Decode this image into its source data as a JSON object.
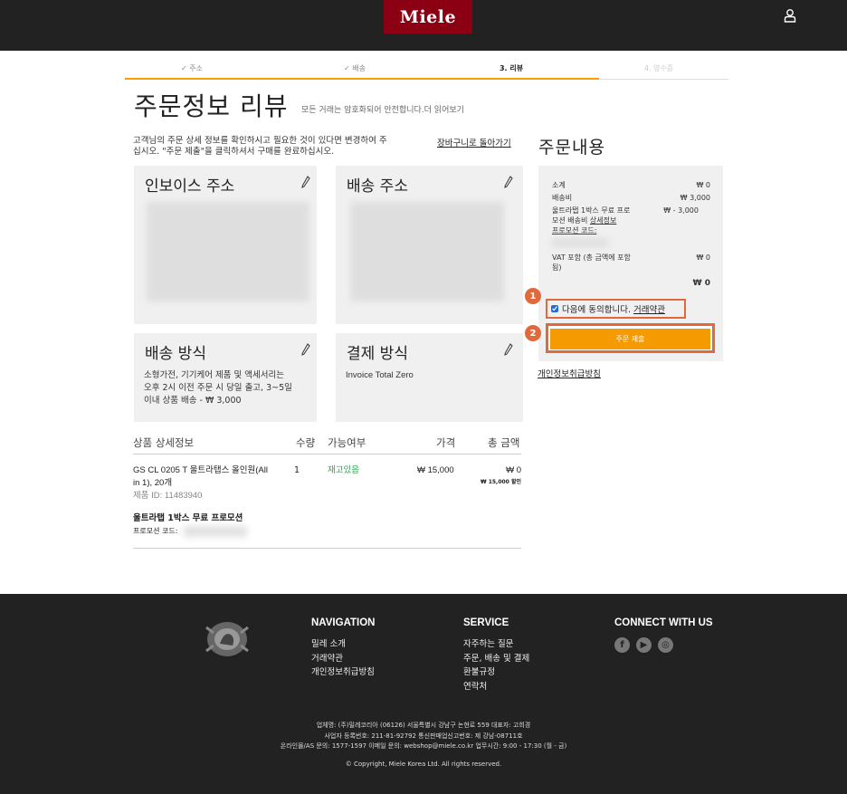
{
  "header": {
    "logo": "Miele",
    "user_icon": "user-icon"
  },
  "steps": [
    {
      "label": "✓ 주소",
      "state": "done"
    },
    {
      "label": "✓ 배송",
      "state": "done"
    },
    {
      "label": "3. 리뷰",
      "state": "active"
    },
    {
      "label": "4. 영수증",
      "state": "future"
    }
  ],
  "page": {
    "title": "주문정보 리뷰",
    "subtitle": "모든 거래는 암호화되어 안전합니다.더 읽어보기",
    "intro_line1": "고객님의 주문 상세 정보를 확인하시고 필요한 것이 있다면 변경하여 주",
    "intro_line2": "십시오. \"주문 제출\"을 클릭하셔서 구매를 완료하십시오.",
    "back_link": "장바구니로 돌아가기"
  },
  "boxes": {
    "invoice": {
      "title": "인보이스 주소"
    },
    "shipping": {
      "title": "배송 주소"
    },
    "delivery": {
      "title": "배송 방식",
      "line1": "소형가전, 기기케어 제품 및 액세서리는",
      "line2": "오후 2시 이전 주문 시 당일 출고, 3~5일",
      "line3": "이내 상품 배송 - ₩ 3,000"
    },
    "payment": {
      "title": "결제 방식",
      "value": "Invoice Total Zero"
    }
  },
  "table": {
    "headers": {
      "product": "상품 상세정보",
      "qty": "수량",
      "avail": "가능여부",
      "price": "가격",
      "total": "총 금액"
    },
    "row": {
      "name1": "GS CL 0205 T 울트라탭스 올인원(All",
      "name2": "in 1), 20개",
      "product_id": "제품 ID: 11483940",
      "qty": "1",
      "avail": "재고있음",
      "price": "₩ 15,000",
      "total": "₩ 0",
      "discount": "₩ 15,000 할인"
    },
    "promo_title": "울트라탭 1박스 무료 프로모션",
    "promo_code_label": "프로모션 코드:"
  },
  "summary": {
    "title": "주문내용",
    "subtotal_label": "소계",
    "subtotal": "₩ 0",
    "shipping_label": "배송비",
    "shipping": "₩ 3,000",
    "promo_line1": "울트라탭 1박스 무료 프로",
    "promo_line2": "모션 배송비",
    "promo_detail": "상세정보",
    "promo_code": "프로모션 코드:",
    "promo_value": "₩ - 3,000",
    "vat_line1": "VAT 포함 (총 금액에 포함",
    "vat_line2": "됨)",
    "vat": "₩ 0",
    "total": "₩ 0",
    "agree_text": "다음에 동의합니다.",
    "agree_link": "거래약관",
    "agree_checked": true,
    "submit": "주문 제출",
    "privacy": "개인정보취급방침",
    "marker1": "1",
    "marker2": "2"
  },
  "footer": {
    "nav_title": "NAVIGATION",
    "nav": [
      "밀레 소개",
      "거래약관",
      "개인정보취급방침"
    ],
    "service_title": "SERVICE",
    "service": [
      "자주하는 질문",
      "주문, 배송 및 결제",
      "환불규정",
      "연락처"
    ],
    "connect_title": "CONNECT WITH US",
    "social": [
      "facebook-icon",
      "youtube-icon",
      "instagram-icon"
    ],
    "legal1": "업체명: (주)밀레코리아   (06126) 서울특별시 강남구 논현로 559   대표자: 고희경",
    "legal2": "사업자 등록번호: 211-81-92792    통신판매업신고번호: 제 강남-08711호",
    "legal3": "온라인몰/AS 문의: 1577-1597   이메일 문의: webshop@miele.co.kr   업무시간: 9:00 - 17:30 (월 - 금)",
    "copyright": "© Copyright, Miele Korea Ltd. All rights reserved."
  },
  "colors": {
    "accent": "#f59a00",
    "brand": "#8c0014",
    "highlight": "#e06a3c",
    "in_stock": "#2e9e4f"
  }
}
